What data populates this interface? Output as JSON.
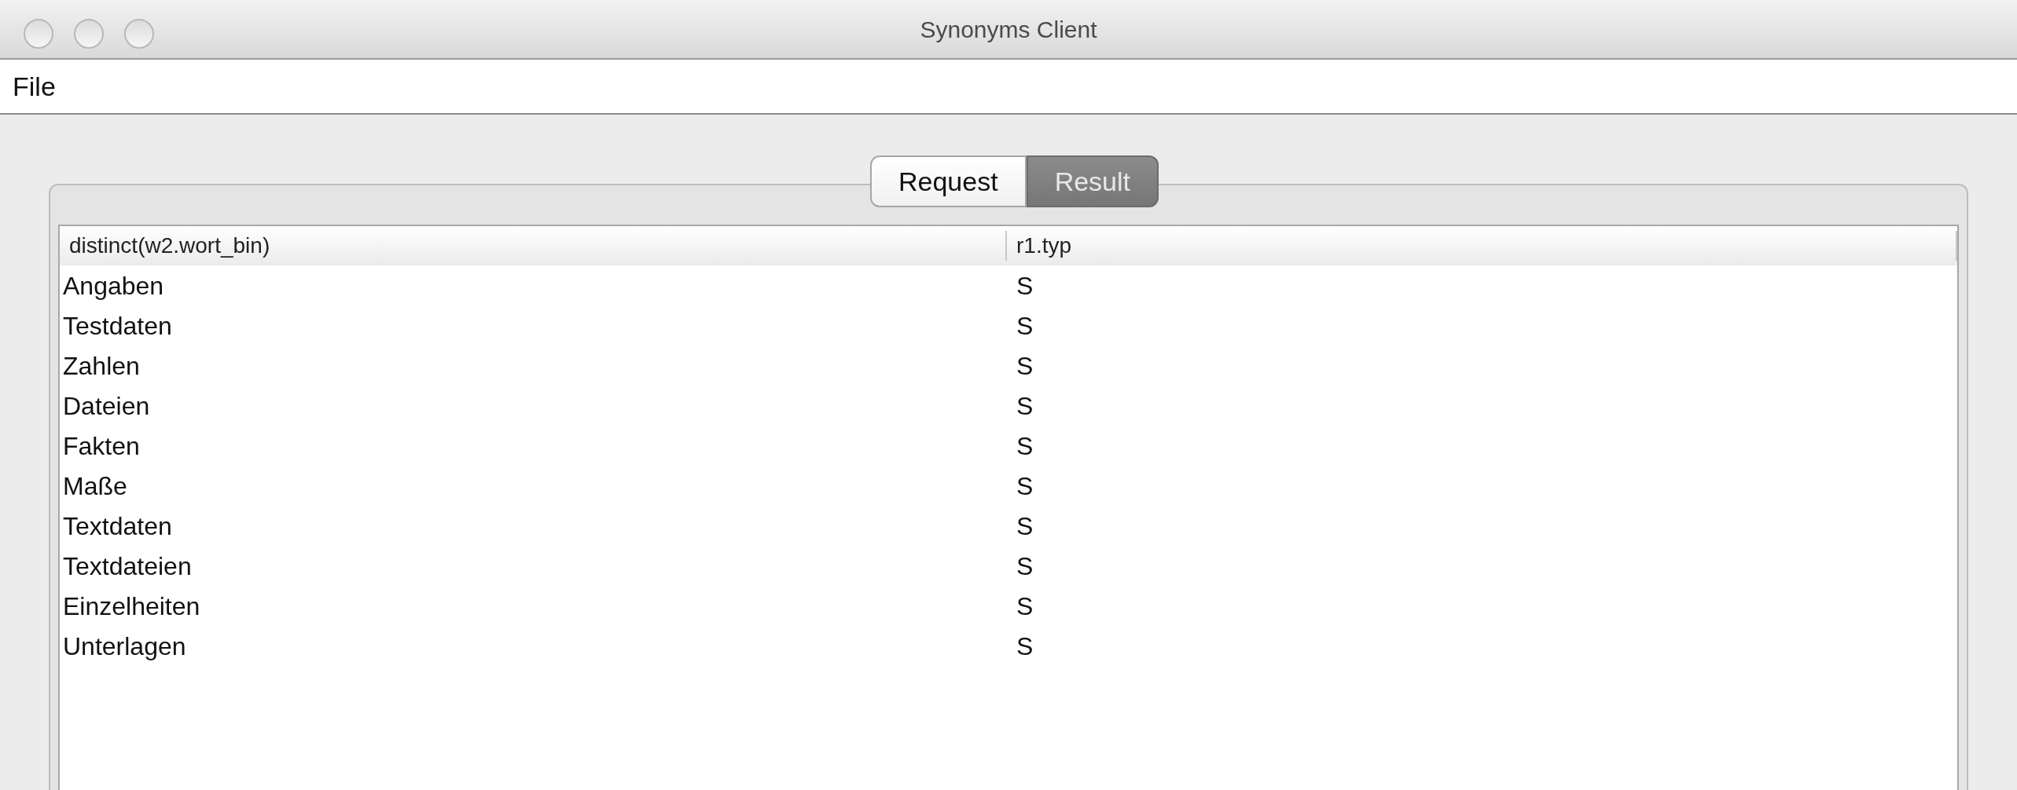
{
  "window": {
    "title": "Synonyms Client"
  },
  "menu": [
    "File"
  ],
  "tabs": [
    {
      "label": "Request",
      "selected": false
    },
    {
      "label": "Result",
      "selected": true
    }
  ],
  "table": {
    "columns": [
      "distinct(w2.wort_bin)",
      "r1.typ"
    ],
    "rows": [
      [
        "Angaben",
        "S"
      ],
      [
        "Testdaten",
        "S"
      ],
      [
        "Zahlen",
        "S"
      ],
      [
        "Dateien",
        "S"
      ],
      [
        "Fakten",
        "S"
      ],
      [
        "Maße",
        "S"
      ],
      [
        "Textdaten",
        "S"
      ],
      [
        "Textdateien",
        "S"
      ],
      [
        "Einzelheiten",
        "S"
      ],
      [
        "Unterlagen",
        "S"
      ]
    ]
  }
}
